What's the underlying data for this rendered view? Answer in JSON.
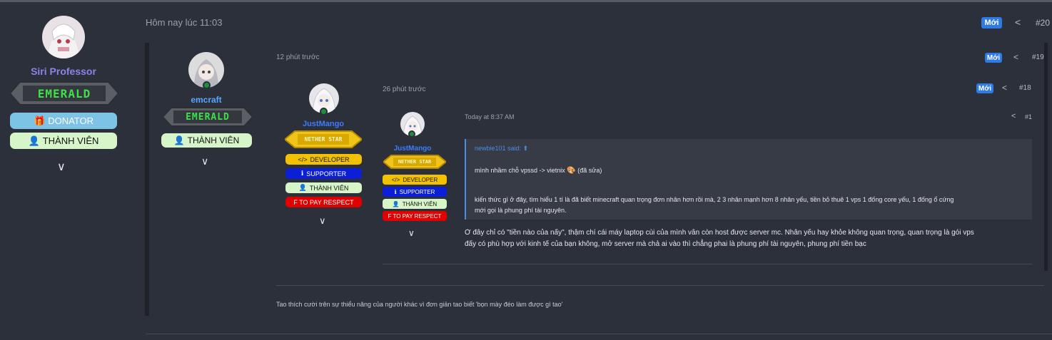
{
  "post20": {
    "user": {
      "name": "Siri Professor",
      "rank": "EMERALD",
      "badges": [
        {
          "icon": "gift-icon",
          "label": "DONATOR"
        },
        {
          "icon": "user-icon",
          "label": "THÀNH VIÊN"
        }
      ]
    },
    "time": "Hôm nay lúc 11:03",
    "new_label": "Mới",
    "number": "#20"
  },
  "post19": {
    "user": {
      "name": "emcraft",
      "rank": "EMERALD",
      "badges": [
        {
          "icon": "user-icon",
          "label": "THÀNH VIÊN"
        }
      ]
    },
    "time": "12 phút trước",
    "new_label": "Mới",
    "number": "#19",
    "signature": "Tao thích cười trên sự thiểu năng của người khác vì đơn giản tao biết 'bọn mày đéo làm được gì tao'"
  },
  "post18": {
    "user": {
      "name": "JustMango",
      "rank": "NETHER STAR",
      "badges": [
        {
          "icon": "code-icon",
          "label": "DEVELOPER"
        },
        {
          "icon": "info-icon",
          "label": "SUPPORTER"
        },
        {
          "icon": "user-icon",
          "label": "THÀNH VIÊN"
        },
        {
          "icon": "",
          "label": "F TO PAY RESPECT"
        }
      ]
    },
    "time": "26 phút trước",
    "new_label": "Mới",
    "number": "#18"
  },
  "post1": {
    "user": {
      "name": "JustMango",
      "rank": "NETHER STAR",
      "badges": [
        {
          "icon": "code-icon",
          "label": "DEVELOPER"
        },
        {
          "icon": "info-icon",
          "label": "SUPPORTER"
        },
        {
          "icon": "user-icon",
          "label": "THÀNH VIÊN"
        },
        {
          "icon": "",
          "label": "F TO PAY RESPECT"
        }
      ]
    },
    "time": "Today at 8:37 AM",
    "number": "#1",
    "quote": {
      "author": "newbie101 said:",
      "line1": "mình nhầm chỗ vpssd -> vietnix",
      "line1_suffix": "(đã sửa)",
      "line2": "kiến thức gì ở đây, tìm hiểu 1 tí là đã biết minecraft quan trọng đơn nhân hơn rồi mà, 2 3 nhân mạnh hơn 8 nhân yếu, tiền bỏ thuê 1 vps 1 đống core yếu, 1 đống ổ cứng",
      "line3": "mới gọi là phung phí tài nguyên."
    },
    "body_line1": "Ở đây chỉ có \"tiền nào của nấy\", thậm chí cái máy laptop cùi của mình vẫn còn host được server mc. Nhân yếu hay khỏe không quan trọng, quan trọng là gói vps",
    "body_line2": "đấy có phù hợp với kinh tế của bạn không, mở server mà chả ai vào thì chẳng phai là phung phí tài nguyên, phung phí tiền bạc"
  },
  "colors": {
    "accent": "#2f7be6",
    "developer": "#f2c200",
    "supporter": "#0a1fd6",
    "member": "#d6f5c8",
    "respect": "#e00000",
    "donator": "#7dc3e6",
    "emerald": "#3ee04a",
    "nether": "#f0c419"
  }
}
